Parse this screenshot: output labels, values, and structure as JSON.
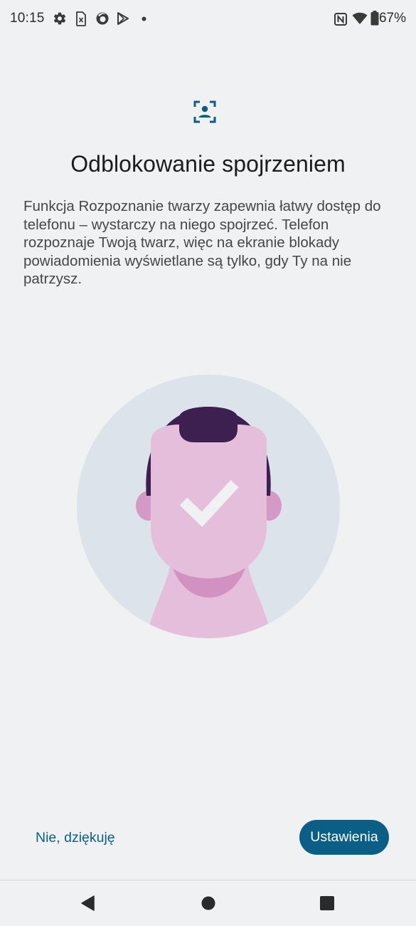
{
  "status_bar": {
    "time": "10:15",
    "battery_percent": "67%",
    "icons": [
      "settings-icon",
      "sim-card-icon",
      "firefox-icon",
      "play-store-icon",
      "notification-dot-icon",
      "nfc-icon",
      "wifi-icon",
      "battery-icon"
    ]
  },
  "main": {
    "header_icon": "face-scan-icon",
    "title": "Odblokowanie spojrzeniem",
    "description": "Funkcja Rozpoznanie twarzy zapewnia łatwy dostęp do telefonu – wystarczy na niego spojrzeć. Telefon rozpoznaje Twoją twarz, więc na ekranie blokady powiadomienia wyświetlane są tylko, gdy Ty na nie patrzysz.",
    "illustration": "face-recognized-illustration"
  },
  "actions": {
    "no_thanks_label": "Nie, dziękuję",
    "settings_label": "Ustawienia"
  },
  "navigation": {
    "buttons": [
      "back-icon",
      "home-icon",
      "recents-icon"
    ]
  },
  "colors": {
    "background": "#eff1f3",
    "accent": "#0b5f86",
    "illustration_circle": "#dde3ea",
    "skin": "#e4bedb",
    "skin_shadow": "#d192c1",
    "hair": "#3e2050"
  }
}
